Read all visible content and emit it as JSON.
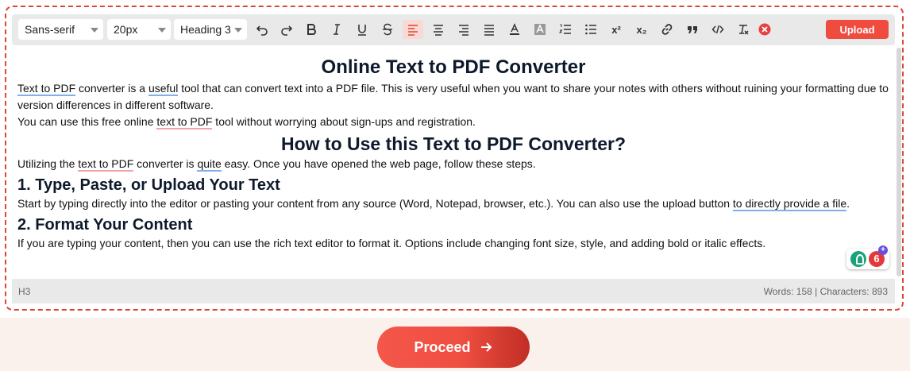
{
  "toolbar": {
    "font_family": "Sans-serif",
    "font_size": "20px",
    "block_format": "Heading 3",
    "upload_label": "Upload",
    "superscript_label": "x²",
    "subscript_label": "x₂"
  },
  "editor": {
    "title": "Online Text to PDF Converter",
    "p1_a": "Text to PDF",
    "p1_b": " converter is a ",
    "p1_c": "useful",
    "p1_d": " tool that can convert text into a PDF file. This is very useful when you want to share your notes with others without ruining your formatting due to version differences in different software.",
    "p2_a": "You can use this free online ",
    "p2_b": "text to PDF",
    "p2_c": " tool without worrying about sign-ups and registration.",
    "h2": "How to Use this Text to PDF Converter?",
    "p3_a": "Utilizing the ",
    "p3_b": "text to PDF",
    "p3_c": " converter is ",
    "p3_d": "quite",
    "p3_e": " easy. Once you have opened the web page, follow these steps.",
    "h3_1": "1. Type, Paste, or Upload Your Text",
    "p4_a": "Start by typing directly into the editor or pasting your content from any source (Word, Notepad, browser, etc.). You can also use the upload button ",
    "p4_b": "to directly provide a file",
    "p4_c": ".",
    "h3_2": "2. Format Your Content",
    "p5": "If you are typing your content, then you can use the rich text editor to format it. Options include changing font size, style, and adding bold or italic effects."
  },
  "status": {
    "element": "H3",
    "counts": "Words: 158 | Characters: 893"
  },
  "extension": {
    "badge": "6",
    "plus": "+"
  },
  "proceed_label": "Proceed",
  "colors": {
    "accent": "#f04b3f",
    "border_dashed": "#e0443a",
    "background": "#fbf1ec"
  }
}
